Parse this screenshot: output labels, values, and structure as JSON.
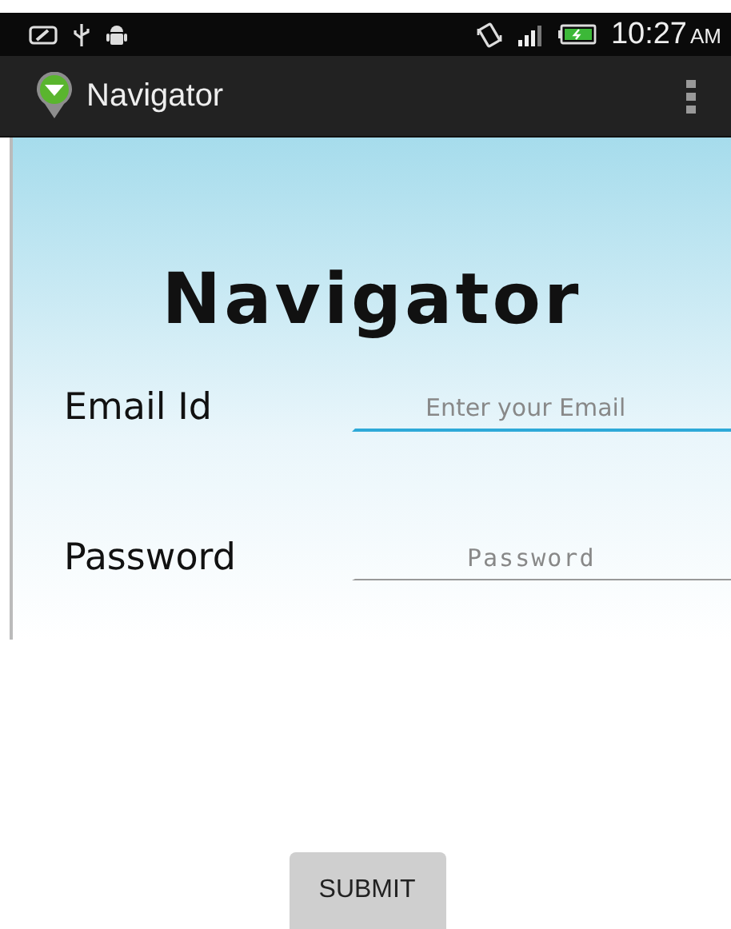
{
  "status_bar": {
    "time": "10:27",
    "meridiem": "AM"
  },
  "action_bar": {
    "title": "Navigator"
  },
  "form": {
    "heading": "Navigator",
    "fields": [
      {
        "label": "Email Id",
        "placeholder": "Enter your Email",
        "kind": "text",
        "focused": true
      },
      {
        "label": "Password",
        "placeholder": "Password",
        "kind": "password",
        "focused": false
      }
    ]
  },
  "buttons": [
    "SUBMIT"
  ]
}
